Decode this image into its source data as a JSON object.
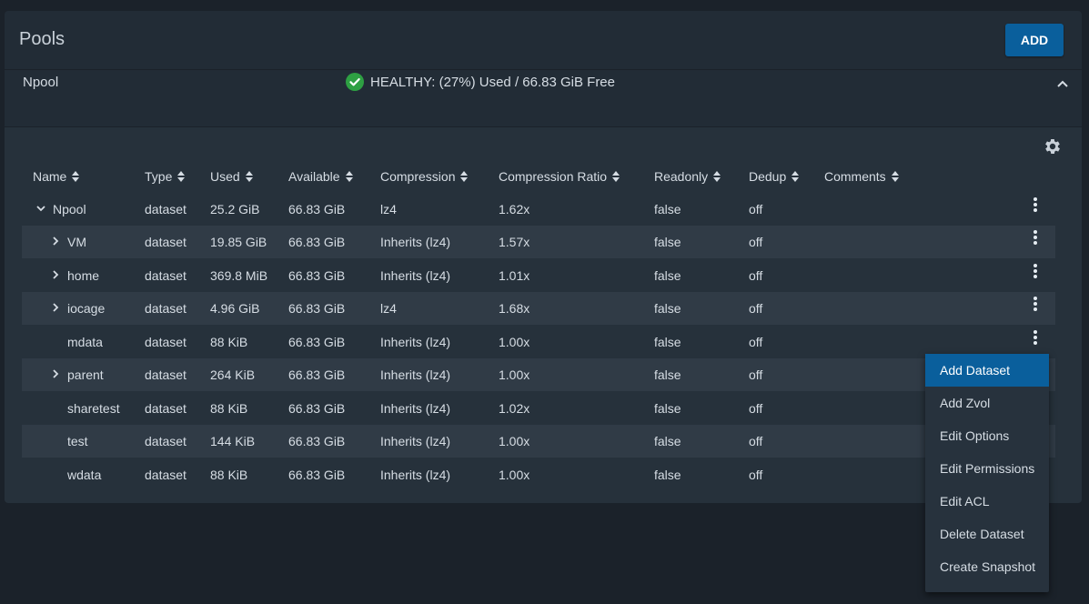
{
  "header": {
    "title": "Pools",
    "add_label": "ADD"
  },
  "pool": {
    "name": "Npool",
    "status": "HEALTHY: (27%) Used / 66.83 GiB Free"
  },
  "columns": [
    "Name",
    "Type",
    "Used",
    "Available",
    "Compression",
    "Compression Ratio",
    "Readonly",
    "Dedup",
    "Comments"
  ],
  "rows": [
    {
      "name": "Npool",
      "type": "dataset",
      "used": "25.2 GiB",
      "available": "66.83 GiB",
      "compression": "lz4",
      "ratio": "1.62x",
      "readonly": "false",
      "dedup": "off"
    },
    {
      "name": "VM",
      "type": "dataset",
      "used": "19.85 GiB",
      "available": "66.83 GiB",
      "compression": "Inherits (lz4)",
      "ratio": "1.57x",
      "readonly": "false",
      "dedup": "off"
    },
    {
      "name": "home",
      "type": "dataset",
      "used": "369.8 MiB",
      "available": "66.83 GiB",
      "compression": "Inherits (lz4)",
      "ratio": "1.01x",
      "readonly": "false",
      "dedup": "off"
    },
    {
      "name": "iocage",
      "type": "dataset",
      "used": "4.96 GiB",
      "available": "66.83 GiB",
      "compression": "lz4",
      "ratio": "1.68x",
      "readonly": "false",
      "dedup": "off"
    },
    {
      "name": "mdata",
      "type": "dataset",
      "used": "88 KiB",
      "available": "66.83 GiB",
      "compression": "Inherits (lz4)",
      "ratio": "1.00x",
      "readonly": "false",
      "dedup": "off"
    },
    {
      "name": "parent",
      "type": "dataset",
      "used": "264 KiB",
      "available": "66.83 GiB",
      "compression": "Inherits (lz4)",
      "ratio": "1.00x",
      "readonly": "false",
      "dedup": "off"
    },
    {
      "name": "sharetest",
      "type": "dataset",
      "used": "88 KiB",
      "available": "66.83 GiB",
      "compression": "Inherits (lz4)",
      "ratio": "1.02x",
      "readonly": "false",
      "dedup": "off"
    },
    {
      "name": "test",
      "type": "dataset",
      "used": "144 KiB",
      "available": "66.83 GiB",
      "compression": "Inherits (lz4)",
      "ratio": "1.00x",
      "readonly": "false",
      "dedup": "off"
    },
    {
      "name": "wdata",
      "type": "dataset",
      "used": "88 KiB",
      "available": "66.83 GiB",
      "compression": "Inherits (lz4)",
      "ratio": "1.00x",
      "readonly": "false",
      "dedup": "off"
    }
  ],
  "menu": [
    "Add Dataset",
    "Add Zvol",
    "Edit Options",
    "Edit Permissions",
    "Edit ACL",
    "Delete Dataset",
    "Create Snapshot"
  ],
  "colors": {
    "accent": "#0a5f9c",
    "healthy": "#2ea043",
    "background": "#1b222a"
  }
}
